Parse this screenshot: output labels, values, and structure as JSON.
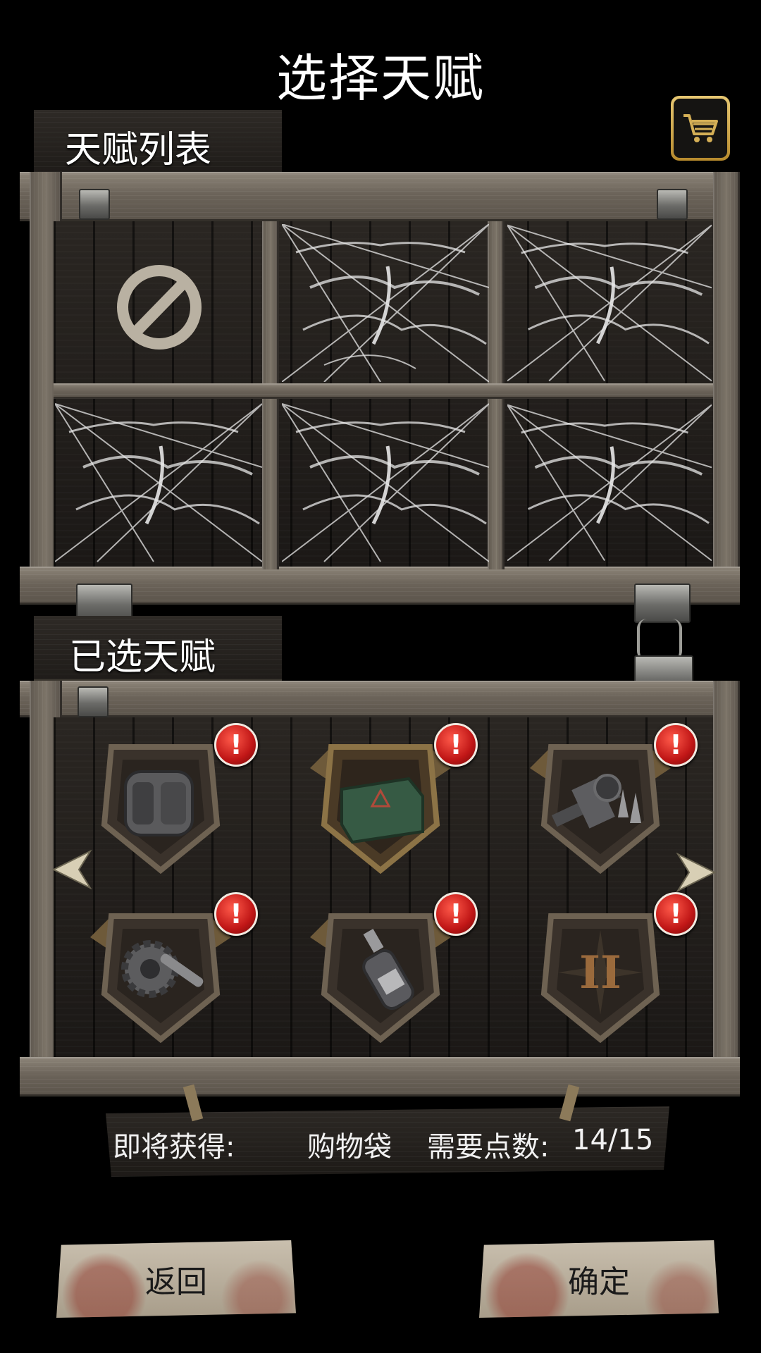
{
  "screen": {
    "title": "选择天赋"
  },
  "talent_list": {
    "title": "天赋列表",
    "slots": [
      {
        "state": "empty",
        "icon": "prohibited-icon"
      },
      {
        "state": "locked",
        "icon": "cobweb"
      },
      {
        "state": "locked",
        "icon": "cobweb"
      },
      {
        "state": "locked",
        "icon": "cobweb"
      },
      {
        "state": "locked",
        "icon": "cobweb"
      },
      {
        "state": "locked",
        "icon": "cobweb"
      }
    ]
  },
  "selected_talents": {
    "title": "已选天赋",
    "items": [
      {
        "icon": "backpack-icon",
        "alert": "!"
      },
      {
        "icon": "ammo-crate-icon",
        "alert": "!"
      },
      {
        "icon": "weapon-parts-icon",
        "alert": "!"
      },
      {
        "icon": "gear-wrench-icon",
        "alert": "!"
      },
      {
        "icon": "bottle-icon",
        "alert": "!"
      },
      {
        "icon": "roman-two-icon",
        "alert": "!"
      }
    ]
  },
  "info": {
    "obtain_label": "即将获得:",
    "obtain_value": "购物袋",
    "points_label": "需要点数:",
    "points_value": "14/15"
  },
  "buttons": {
    "back": "返回",
    "confirm": "确定"
  },
  "colors": {
    "alert_red": "#c01616",
    "cart_gold": "#d4af56"
  }
}
